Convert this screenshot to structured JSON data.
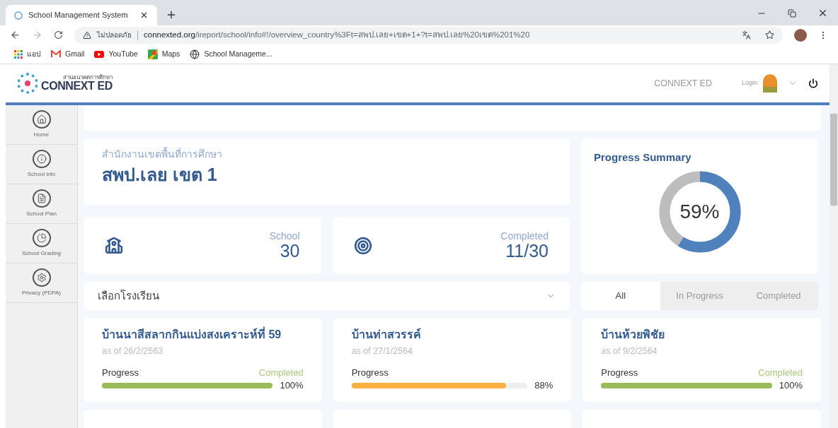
{
  "browser": {
    "tab_title": "School Management System",
    "security": "ไม่ปลอดภัย",
    "url_host": "connexted.org",
    "url_path": "/ireport/school/info#!/overview_country%3Ft=สพป.เลย+เขต+1+?t=สพป.เลย%20เขต%201%20",
    "bookmarks": [
      {
        "kind": "apps",
        "label": "แอป"
      },
      {
        "kind": "gmail",
        "label": "Gmail"
      },
      {
        "kind": "youtube",
        "label": "YouTube"
      },
      {
        "kind": "maps",
        "label": "Maps"
      },
      {
        "kind": "globe",
        "label": "School Manageme..."
      }
    ]
  },
  "header": {
    "logo_tagline": "สานอนาคตการศึกษา",
    "logo_text": "CONNEXT ED",
    "brand": "CONNEXT ED",
    "login": "Login"
  },
  "sidebar": {
    "items": [
      {
        "kind": "home",
        "label": "Home"
      },
      {
        "kind": "info",
        "label": "School info"
      },
      {
        "kind": "plan",
        "label": "School Plan"
      },
      {
        "kind": "grading",
        "label": "School Grading"
      },
      {
        "kind": "privacy",
        "label": "Privacy (PDPA)"
      }
    ]
  },
  "region": {
    "caption": "สำนักงานเขตพื้นที่การศึกษา",
    "name": "สพป.เลย เขต 1"
  },
  "stats": [
    {
      "kind": "school",
      "label": "School",
      "value": "30"
    },
    {
      "kind": "completed",
      "label": "Completed",
      "value": "11/30"
    }
  ],
  "summary": {
    "title": "Progress Summary",
    "level": 0.59,
    "reading": "59%"
  },
  "dropdown": {
    "value": "เลือกโรงเรียน"
  },
  "filters": [
    {
      "label": "All",
      "selected": true
    },
    {
      "label": "In Progress",
      "selected": false
    },
    {
      "label": "Completed",
      "selected": false
    }
  ],
  "schools": [
    {
      "name": "บ้านนาสีสลากกินแบ่งสงเคราะห์ที่ 59",
      "date": "as of 26/2/2563",
      "progress_label": "Progress",
      "status": "Completed",
      "kind": "completed",
      "level": 1.0,
      "reading": "100%"
    },
    {
      "name": "บ้านท่าสวรรค์",
      "date": "as of 27/1/2564",
      "progress_label": "Progress",
      "kind": "in_progress",
      "level": 0.88,
      "reading": "88%"
    },
    {
      "name": "บ้านห้วยพิชัย",
      "date": "as of 9/2/2564",
      "progress_label": "Progress",
      "status": "Completed",
      "kind": "completed",
      "level": 1.0,
      "reading": "100%"
    }
  ]
}
